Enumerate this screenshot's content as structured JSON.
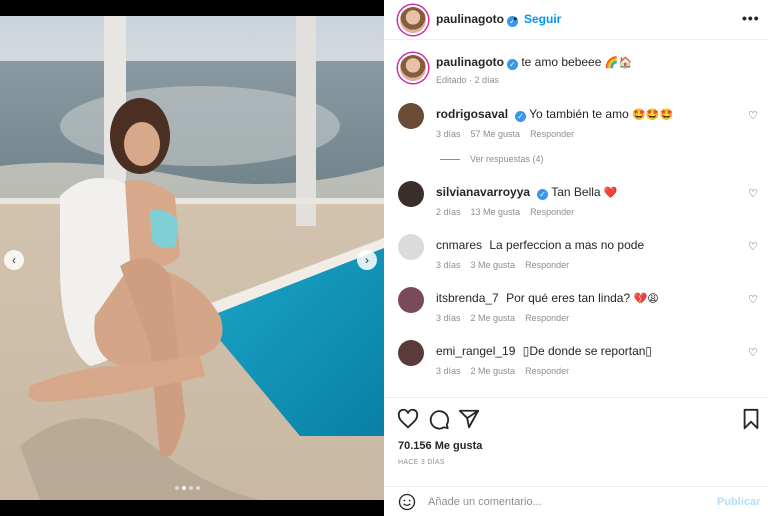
{
  "post": {
    "username": "paulinagoto",
    "follow_label": "Seguir",
    "caption": "te amo bebeee",
    "caption_emoji": "🌈🏠",
    "caption_meta": "Editado · 2 días",
    "media_dots": 4,
    "media_active_dot": 2
  },
  "comments": [
    {
      "username": "rodrigosaval",
      "verified": true,
      "text": "Yo también te amo",
      "emoji": "🤩🤩🤩",
      "time": "3 días",
      "likes": "57 Me gusta",
      "reply": "Responder",
      "avatar_color": "#6b4a36"
    },
    {
      "username": "silvianavarroyya",
      "verified": true,
      "text": "Tan Bella",
      "emoji": "❤️",
      "time": "2 días",
      "likes": "13 Me gusta",
      "reply": "Responder",
      "avatar_color": "#3a2e2a"
    },
    {
      "username": "cnmares",
      "verified": false,
      "text": "La perfeccion a mas no pode",
      "emoji": "",
      "time": "3 días",
      "likes": "3 Me gusta",
      "reply": "Responder",
      "avatar_color": "#dbdbdb"
    },
    {
      "username": "itsbrenda_7",
      "verified": false,
      "text": "Por qué eres tan linda?",
      "emoji": "💔😩",
      "time": "3 días",
      "likes": "2 Me gusta",
      "reply": "Responder",
      "avatar_color": "#7a4a5a"
    },
    {
      "username": "emi_rangel_19",
      "verified": false,
      "text": "▯De donde se reportan▯",
      "emoji": "",
      "time": "3 días",
      "likes": "2 Me gusta",
      "reply": "Responder",
      "avatar_color": "#5a3a3a"
    }
  ],
  "view_replies": "Ver respuestas (4)",
  "likes_count": "70.156 Me gusta",
  "posted_ago": "HACE 3 DÍAS",
  "add_comment_placeholder": "Añade un comentario...",
  "publish_label": "Publicar",
  "icons": {
    "more": "more-options-icon",
    "like": "heart-outline-icon",
    "comment": "comment-bubble-icon",
    "share": "paper-plane-icon",
    "save": "bookmark-icon",
    "emoji": "smile-face-icon"
  },
  "colors": {
    "accent": "#0095f6",
    "publish_disabled": "#b2dffc",
    "verified": "#3897f0"
  }
}
